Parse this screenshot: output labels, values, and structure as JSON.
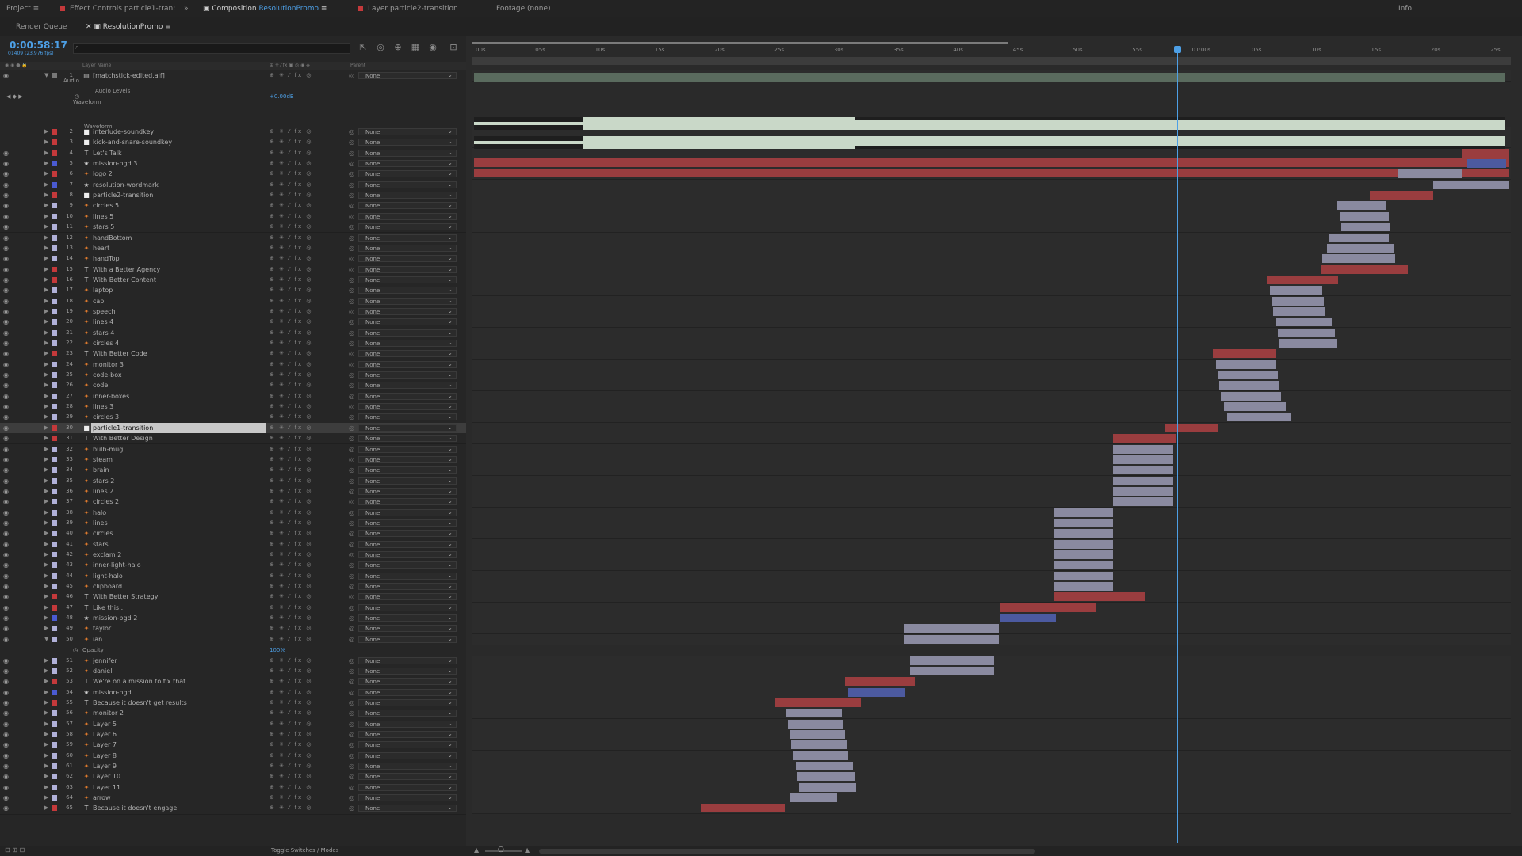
{
  "tabs": {
    "project": "Project",
    "effect_controls": "Effect Controls particle1-tran:",
    "composition_prefix": "Composition",
    "composition_name": "ResolutionPromo",
    "layer": "Layer particle2-transition",
    "footage": "Footage (none)",
    "info": "Info"
  },
  "subtabs": {
    "render_queue": "Render Queue",
    "comp": "ResolutionPromo"
  },
  "timecode": "0:00:58:17",
  "fps": "01409 (23.976 fps)",
  "columns": {
    "layer_name": "Layer Name",
    "parent": "Parent"
  },
  "parent_value": "None",
  "audio": {
    "group": "Audio",
    "levels": "Audio Levels",
    "levels_value": "+0.00dB",
    "waveform_group": "Waveform",
    "waveform_label": "Waveform"
  },
  "opacity": {
    "label": "Opacity",
    "value": "100%"
  },
  "bottom": {
    "toggle": "Toggle Switches / Modes"
  },
  "ruler": [
    "00s",
    "05s",
    "10s",
    "15s",
    "20s",
    "25s",
    "30s",
    "35s",
    "40s",
    "45s",
    "50s",
    "55s",
    "01:00s",
    "05s",
    "10s",
    "15s",
    "20s",
    "25s"
  ],
  "colors": {
    "accent": "#4d9fe5",
    "red_bar": "#9a3d3f",
    "lav_bar": "#8a8aa0",
    "blue_bar": "#4c5aa0",
    "waveform": "#c9d8c8"
  },
  "layers": [
    {
      "n": "1",
      "name": "[matchstick-edited.aif]",
      "icon": "file",
      "c": "#777"
    },
    {
      "n": "2",
      "name": "interlude-soundkey",
      "icon": "box",
      "c": "#c4393b"
    },
    {
      "n": "3",
      "name": "kick-and-snare-soundkey",
      "icon": "box",
      "c": "#c4393b"
    },
    {
      "n": "4",
      "name": "Let's Talk",
      "icon": "T",
      "c": "#c4393b"
    },
    {
      "n": "5",
      "name": "mission-bgd 3",
      "icon": "star",
      "c": "#4a5ad1"
    },
    {
      "n": "6",
      "name": "logo 2",
      "icon": "shape",
      "c": "#c4393b"
    },
    {
      "n": "7",
      "name": "resolution-wordmark",
      "icon": "star",
      "c": "#4a5ad1"
    },
    {
      "n": "8",
      "name": "particle2-transition",
      "icon": "box",
      "c": "#c4393b"
    },
    {
      "n": "9",
      "name": "circles 5",
      "icon": "shape",
      "c": "#b0b0d8"
    },
    {
      "n": "10",
      "name": "lines 5",
      "icon": "shape",
      "c": "#b0b0d8"
    },
    {
      "n": "11",
      "name": "stars 5",
      "icon": "shape",
      "c": "#b0b0d8"
    },
    {
      "n": "12",
      "name": "handBottom",
      "icon": "shape",
      "c": "#b0b0d8"
    },
    {
      "n": "13",
      "name": "heart",
      "icon": "shape",
      "c": "#b0b0d8"
    },
    {
      "n": "14",
      "name": "handTop",
      "icon": "shape",
      "c": "#b0b0d8"
    },
    {
      "n": "15",
      "name": "With a Better Agency",
      "icon": "T",
      "c": "#c4393b"
    },
    {
      "n": "16",
      "name": "With Better Content",
      "icon": "T",
      "c": "#c4393b"
    },
    {
      "n": "17",
      "name": "laptop",
      "icon": "shape",
      "c": "#b0b0d8"
    },
    {
      "n": "18",
      "name": "cap",
      "icon": "shape",
      "c": "#b0b0d8"
    },
    {
      "n": "19",
      "name": "speech",
      "icon": "shape",
      "c": "#b0b0d8"
    },
    {
      "n": "20",
      "name": "lines 4",
      "icon": "shape",
      "c": "#b0b0d8"
    },
    {
      "n": "21",
      "name": "stars 4",
      "icon": "shape",
      "c": "#b0b0d8"
    },
    {
      "n": "22",
      "name": "circles 4",
      "icon": "shape",
      "c": "#b0b0d8"
    },
    {
      "n": "23",
      "name": "With Better Code",
      "icon": "T",
      "c": "#c4393b"
    },
    {
      "n": "24",
      "name": "monitor 3",
      "icon": "shape",
      "c": "#b0b0d8"
    },
    {
      "n": "25",
      "name": "code-box",
      "icon": "shape",
      "c": "#b0b0d8"
    },
    {
      "n": "26",
      "name": "code",
      "icon": "shape",
      "c": "#b0b0d8"
    },
    {
      "n": "27",
      "name": "inner-boxes",
      "icon": "shape",
      "c": "#b0b0d8"
    },
    {
      "n": "28",
      "name": "lines 3",
      "icon": "shape",
      "c": "#b0b0d8"
    },
    {
      "n": "29",
      "name": "circles 3",
      "icon": "shape",
      "c": "#b0b0d8"
    },
    {
      "n": "30",
      "name": "particle1-transition",
      "icon": "box",
      "c": "#c4393b"
    },
    {
      "n": "31",
      "name": "With Better Design",
      "icon": "T",
      "c": "#c4393b"
    },
    {
      "n": "32",
      "name": "bulb-mug",
      "icon": "shape",
      "c": "#b0b0d8"
    },
    {
      "n": "33",
      "name": "steam",
      "icon": "shape",
      "c": "#b0b0d8"
    },
    {
      "n": "34",
      "name": "brain",
      "icon": "shape",
      "c": "#b0b0d8"
    },
    {
      "n": "35",
      "name": "stars 2",
      "icon": "shape",
      "c": "#b0b0d8"
    },
    {
      "n": "36",
      "name": "lines 2",
      "icon": "shape",
      "c": "#b0b0d8"
    },
    {
      "n": "37",
      "name": "circles 2",
      "icon": "shape",
      "c": "#b0b0d8"
    },
    {
      "n": "38",
      "name": "halo",
      "icon": "shape",
      "c": "#b0b0d8"
    },
    {
      "n": "39",
      "name": "lines",
      "icon": "shape",
      "c": "#b0b0d8"
    },
    {
      "n": "40",
      "name": "circles",
      "icon": "shape",
      "c": "#b0b0d8"
    },
    {
      "n": "41",
      "name": "stars",
      "icon": "shape",
      "c": "#b0b0d8"
    },
    {
      "n": "42",
      "name": "exclam 2",
      "icon": "shape",
      "c": "#b0b0d8"
    },
    {
      "n": "43",
      "name": "inner-light-halo",
      "icon": "shape",
      "c": "#b0b0d8"
    },
    {
      "n": "44",
      "name": "light-halo",
      "icon": "shape",
      "c": "#b0b0d8"
    },
    {
      "n": "45",
      "name": "clipboard",
      "icon": "shape",
      "c": "#b0b0d8"
    },
    {
      "n": "46",
      "name": "With Better Strategy",
      "icon": "T",
      "c": "#c4393b"
    },
    {
      "n": "47",
      "name": "Like this...",
      "icon": "T",
      "c": "#c4393b"
    },
    {
      "n": "48",
      "name": "mission-bgd 2",
      "icon": "star",
      "c": "#4a5ad1"
    },
    {
      "n": "49",
      "name": "taylor",
      "icon": "shape",
      "c": "#b0b0d8"
    },
    {
      "n": "50",
      "name": "ian",
      "icon": "shape",
      "c": "#b0b0d8"
    },
    {
      "n": "51",
      "name": "jennifer",
      "icon": "shape",
      "c": "#b0b0d8"
    },
    {
      "n": "52",
      "name": "daniel",
      "icon": "shape",
      "c": "#b0b0d8"
    },
    {
      "n": "53",
      "name": "We're on a mission to fix that.",
      "icon": "T",
      "c": "#c4393b"
    },
    {
      "n": "54",
      "name": "mission-bgd",
      "icon": "star",
      "c": "#4a5ad1"
    },
    {
      "n": "55",
      "name": "Because it doesn't get results",
      "icon": "T",
      "c": "#c4393b"
    },
    {
      "n": "56",
      "name": "monitor 2",
      "icon": "shape",
      "c": "#b0b0d8"
    },
    {
      "n": "57",
      "name": "Layer 5",
      "icon": "shape",
      "c": "#b0b0d8"
    },
    {
      "n": "58",
      "name": "Layer 6",
      "icon": "shape",
      "c": "#b0b0d8"
    },
    {
      "n": "59",
      "name": "Layer 7",
      "icon": "shape",
      "c": "#b0b0d8"
    },
    {
      "n": "60",
      "name": "Layer 8",
      "icon": "shape",
      "c": "#b0b0d8"
    },
    {
      "n": "61",
      "name": "Layer 9",
      "icon": "shape",
      "c": "#b0b0d8"
    },
    {
      "n": "62",
      "name": "Layer 10",
      "icon": "shape",
      "c": "#b0b0d8"
    },
    {
      "n": "63",
      "name": "Layer 11",
      "icon": "shape",
      "c": "#b0b0d8"
    },
    {
      "n": "64",
      "name": "arrow",
      "icon": "shape",
      "c": "#b0b0d8"
    },
    {
      "n": "65",
      "name": "Because it doesn't engage",
      "icon": "T",
      "c": "#c4393b"
    }
  ]
}
